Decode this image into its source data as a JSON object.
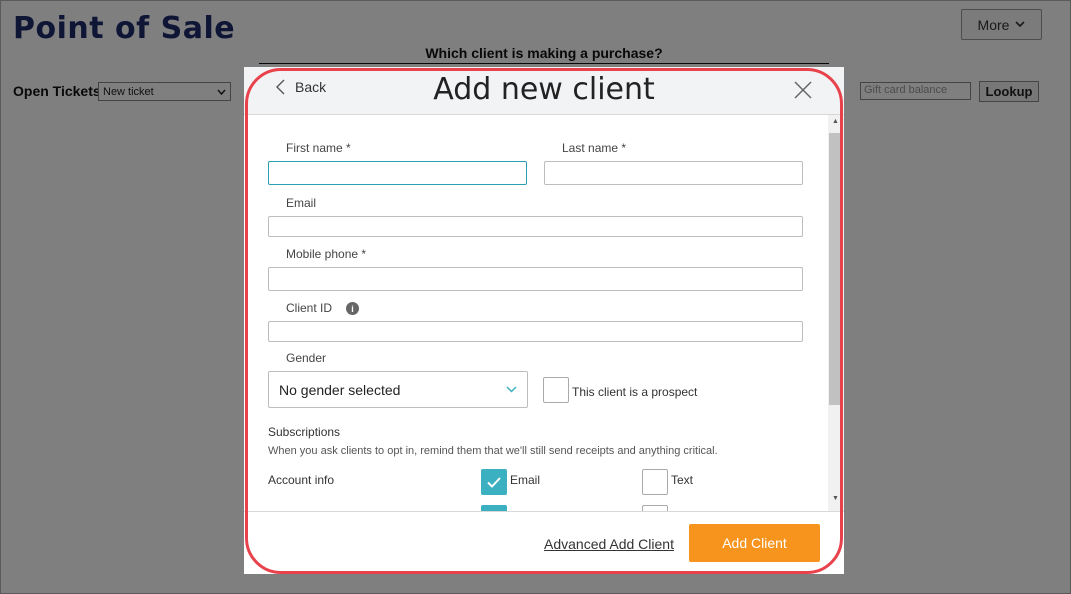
{
  "page": {
    "title": "Point of Sale",
    "more_label": "More",
    "client_question": "Which client is making a purchase?",
    "open_tickets_label": "Open Tickets",
    "ticket_select_value": "New ticket",
    "gift_card_placeholder": "Gift card balance",
    "lookup_label": "Lookup"
  },
  "modal": {
    "back_label": "Back",
    "title": "Add new client",
    "fields": {
      "first_name_label": "First name *",
      "last_name_label": "Last name *",
      "email_label": "Email",
      "mobile_phone_label": "Mobile phone *",
      "client_id_label": "Client ID",
      "gender_label": "Gender",
      "gender_value": "No gender selected",
      "prospect_label": "This client is a prospect"
    },
    "subscriptions": {
      "title": "Subscriptions",
      "note": "When you ask clients to opt in, remind them that we'll still send receipts and anything critical.",
      "rows": [
        {
          "label": "Account info",
          "email_label": "Email",
          "email_checked": true,
          "text_label": "Text",
          "text_checked": false
        },
        {
          "label": "",
          "email_label": "",
          "email_checked": true,
          "text_label": "",
          "text_checked": false
        }
      ]
    },
    "footer": {
      "advanced_label": "Advanced Add Client",
      "add_label": "Add Client"
    }
  },
  "colors": {
    "accent": "#3ab0c0",
    "primary_button": "#f7941d",
    "highlight": "#e8434d",
    "title": "#1f2a6b"
  }
}
